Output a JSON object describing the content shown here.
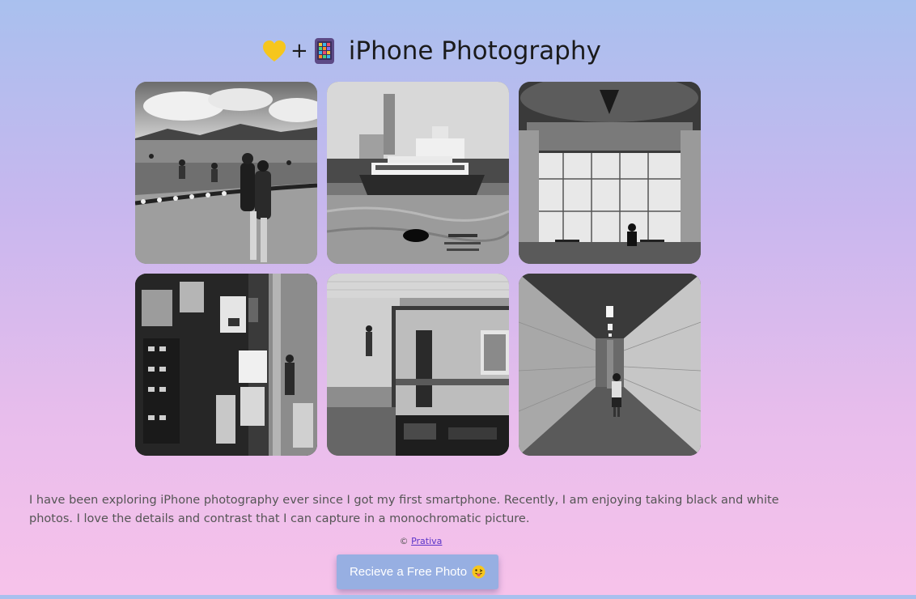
{
  "header": {
    "icons": [
      "yellow-heart-icon",
      "plus-sign",
      "mobile-phone-icon"
    ],
    "plus": "+",
    "title": "iPhone Photography"
  },
  "gallery": {
    "photos": [
      {
        "subject": "beach-with-people-in-water"
      },
      {
        "subject": "star-ferry-at-pier"
      },
      {
        "subject": "ornate-hall-with-windows"
      },
      {
        "subject": "street-stall-with-signs"
      },
      {
        "subject": "train-at-platform"
      },
      {
        "subject": "tiled-tunnel-with-walker"
      }
    ]
  },
  "description": "I have been exploring iPhone photography ever since I got my first smartphone. Recently, I am enjoying taking black and white photos. I love the details and contrast that I can capture in a monochromatic picture.",
  "footer": {
    "copyright_symbol": "©",
    "author": "Prativa"
  },
  "cta": {
    "label": "Recieve a Free Photo",
    "emoji": "smiling-face-with-tongue-icon"
  },
  "colors": {
    "gradient_top": "#a9c0ee",
    "gradient_bottom": "#f7c2ea",
    "button": "#97afe2",
    "link": "#5a34c8",
    "text": "#555555"
  }
}
